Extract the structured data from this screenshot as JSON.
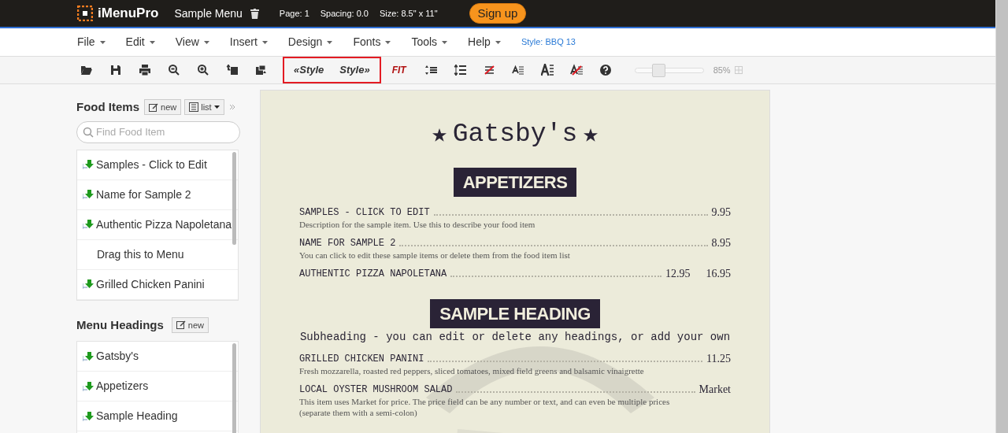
{
  "header": {
    "logo": "iMenuPro",
    "menu_name": "Sample Menu",
    "info": [
      "Page: 1",
      "Spacing: 0.0",
      "Size: 8.5\" x 11\""
    ],
    "signup": "Sign up"
  },
  "menubar": {
    "items": [
      "File",
      "Edit",
      "View",
      "Insert",
      "Design",
      "Fonts",
      "Tools",
      "Help"
    ],
    "style_label": "Style: BBQ 13"
  },
  "toolbar": {
    "style_prev": "«Style",
    "style_next": "Style»",
    "fit": "FIT",
    "zoom": {
      "level": 0.34,
      "reading": "85%"
    }
  },
  "food_items": {
    "title": "Food Items",
    "new_button": "new",
    "list_button": "list",
    "search_placeholder": "Find Food Item",
    "items": [
      {
        "kind": "item",
        "label": "Samples - Click to Edit"
      },
      {
        "kind": "item",
        "label": "Name for Sample 2"
      },
      {
        "kind": "item",
        "label": "Authentic Pizza Napoletana"
      },
      {
        "kind": "hint",
        "label": "Drag this to Menu"
      },
      {
        "kind": "item",
        "label": "Grilled Chicken Panini"
      }
    ]
  },
  "menu_headings": {
    "title": "Menu Headings",
    "new_button": "new",
    "items": [
      {
        "kind": "item",
        "label": "Gatsby's"
      },
      {
        "kind": "item",
        "label": "Appetizers"
      },
      {
        "kind": "item",
        "label": "Sample Heading"
      }
    ]
  },
  "menu_page": {
    "title": "Gatsby's",
    "sections": [
      {
        "heading": "APPETIZERS",
        "items": [
          {
            "name": "SAMPLES - CLICK TO EDIT",
            "description": "Description for the sample item. Use this to describe your food item",
            "prices": [
              "9.95"
            ]
          },
          {
            "name": "NAME FOR SAMPLE 2",
            "description": "You can click to edit these sample items or delete them from the food item list",
            "prices": [
              "8.95"
            ]
          },
          {
            "name": "AUTHENTIC PIZZA NAPOLETANA",
            "prices": [
              "12.95",
              "16.95"
            ]
          }
        ]
      },
      {
        "heading": "SAMPLE HEADING",
        "subheading": "Subheading - you can edit or delete any headings, or add your own",
        "items": [
          {
            "name": "GRILLED CHICKEN PANINI",
            "description": "Fresh mozzarella, roasted red peppers, sliced tomatoes, mixed field greens and balsamic vinaigrette",
            "prices": [
              "11.25"
            ]
          },
          {
            "name": "LOCAL OYSTER MUSHROOM SALAD",
            "description": "This item uses Market for price. The price field can be any number or text, and can even be multiple prices (separate them with a semi-colon)",
            "prices": [
              "Market"
            ]
          }
        ]
      }
    ]
  }
}
